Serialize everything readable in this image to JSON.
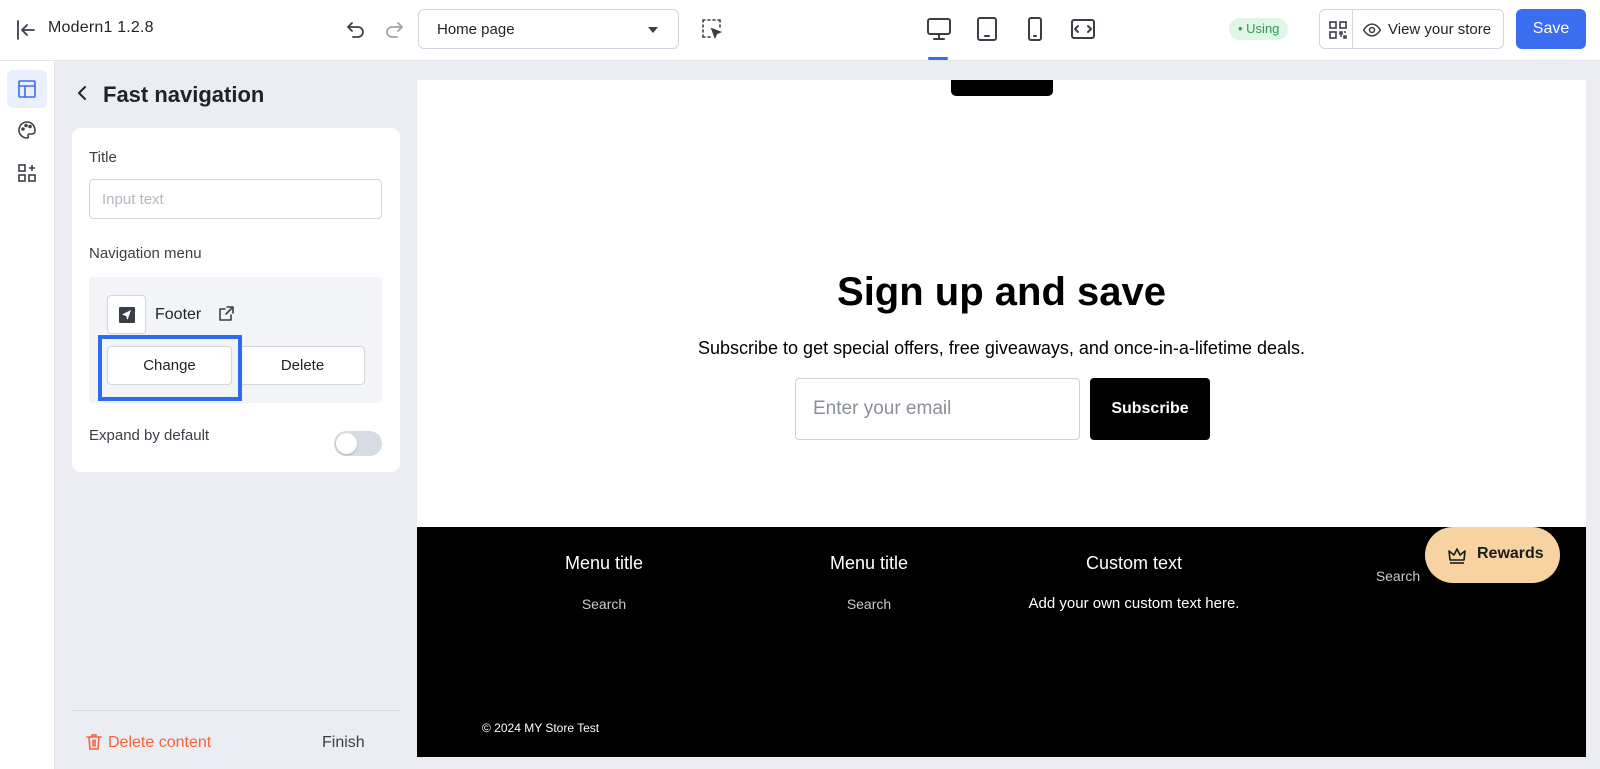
{
  "topbar": {
    "app_title": "Modern1  1.2.8",
    "page_select_value": "Home page",
    "using_badge": "• Using",
    "view_store_label": "View your store",
    "save_label": "Save"
  },
  "rail": {
    "items": [
      {
        "name": "layout-icon",
        "active": true
      },
      {
        "name": "palette-icon",
        "active": false
      },
      {
        "name": "add-block-icon",
        "active": false
      }
    ]
  },
  "panel": {
    "title": "Fast navigation",
    "title_field_label": "Title",
    "title_field_placeholder": "Input text",
    "title_field_value": "",
    "navigation_menu_label": "Navigation menu",
    "menu_name": "Footer",
    "change_label": "Change",
    "delete_label": "Delete",
    "expand_label": "Expand by default",
    "expand_on": false,
    "delete_content_label": "Delete content",
    "finish_label": "Finish"
  },
  "preview": {
    "signup_title": "Sign up and save",
    "signup_subtitle": "Subscribe to get special offers, free giveaways, and once-in-a-lifetime deals.",
    "email_placeholder": "Enter your email",
    "subscribe_label": "Subscribe",
    "footer": {
      "col1_title": "Menu title",
      "col1_item": "Search",
      "col2_title": "Menu title",
      "col2_item": "Search",
      "col3_title": "Custom text",
      "col3_text": "Add your own custom text here.",
      "col4_item": "Search",
      "copyright": "© 2024 MY Store Test"
    },
    "rewards_label": "Rewards"
  },
  "colors": {
    "accent": "#3a6df0",
    "highlight": "#2f6bf0",
    "danger": "#f2643c",
    "using_bg": "#def7e5",
    "using_text": "#2f9a52",
    "rewards_bg": "#f6d3a0"
  }
}
